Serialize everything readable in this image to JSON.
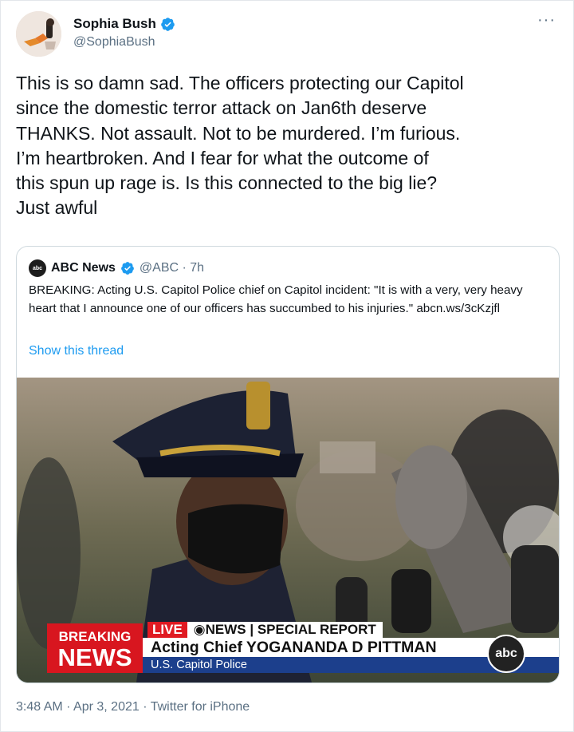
{
  "author": {
    "display_name": "Sophia Bush",
    "handle": "@SophiaBush"
  },
  "more_icon": "more-icon",
  "tweet": {
    "text": "This is so damn sad. The officers protecting our Capitol\nsince the domestic terror attack on Jan6th deserve\nTHANKS. Not assault. Not to be murdered. I’m furious.\nI’m heartbroken. And I fear for what the outcome of\nthis spun up rage is. Is this connected to the big lie?\nJust awful"
  },
  "quoted": {
    "display_name": "ABC News",
    "handle_time": "@ABC · 7h",
    "logo_text": "abc NEWS",
    "text": "BREAKING: Acting U.S. Capitol Police chief on Capitol incident: \"It is with a very, very heavy heart that I announce one of our officers has succumbed to his injuries.\" abcn.ws/3cKzjfl",
    "show_thread": "Show this thread",
    "media": {
      "breaking_line1": "BREAKING",
      "breaking_line2": "NEWS",
      "live": "LIVE",
      "network": "NEWS",
      "special_report": "SPECIAL REPORT",
      "headline": "Acting Chief YOGANANDA D PITTMAN",
      "subline": "U.S. Capitol Police",
      "bug": "abc"
    }
  },
  "footer": {
    "meta": "3:48 AM · Apr 3, 2021 · Twitter for iPhone"
  },
  "colors": {
    "accent": "#1d9bf0",
    "secondary_text": "#5b7083",
    "breaking_red": "#d8161f",
    "lower_third_blue": "#1c3f8c"
  }
}
